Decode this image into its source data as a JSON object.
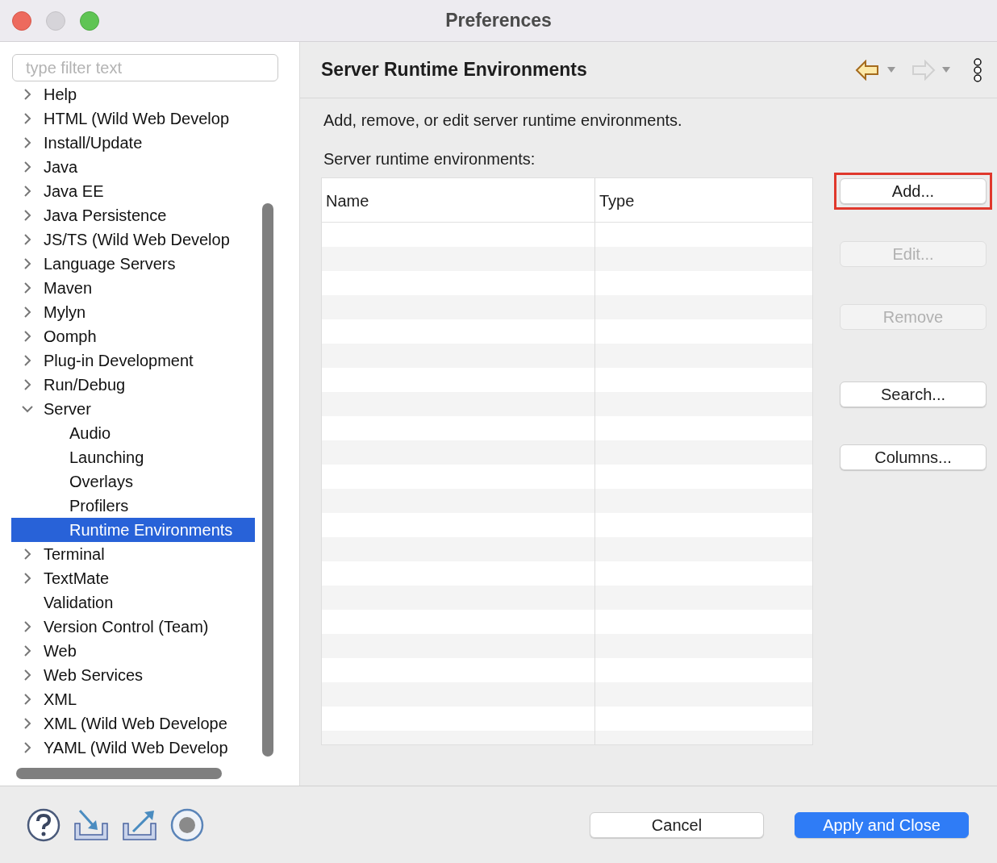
{
  "window": {
    "title": "Preferences"
  },
  "filter": {
    "placeholder": "type filter text"
  },
  "tree": [
    {
      "label": "Help",
      "expandable": true,
      "expanded": false,
      "selected": false
    },
    {
      "label": "HTML (Wild Web Develop",
      "expandable": true,
      "expanded": false,
      "selected": false
    },
    {
      "label": "Install/Update",
      "expandable": true,
      "expanded": false,
      "selected": false
    },
    {
      "label": "Java",
      "expandable": true,
      "expanded": false,
      "selected": false
    },
    {
      "label": "Java EE",
      "expandable": true,
      "expanded": false,
      "selected": false
    },
    {
      "label": "Java Persistence",
      "expandable": true,
      "expanded": false,
      "selected": false
    },
    {
      "label": "JS/TS (Wild Web Develop",
      "expandable": true,
      "expanded": false,
      "selected": false
    },
    {
      "label": "Language Servers",
      "expandable": true,
      "expanded": false,
      "selected": false
    },
    {
      "label": "Maven",
      "expandable": true,
      "expanded": false,
      "selected": false
    },
    {
      "label": "Mylyn",
      "expandable": true,
      "expanded": false,
      "selected": false
    },
    {
      "label": "Oomph",
      "expandable": true,
      "expanded": false,
      "selected": false
    },
    {
      "label": "Plug-in Development",
      "expandable": true,
      "expanded": false,
      "selected": false
    },
    {
      "label": "Run/Debug",
      "expandable": true,
      "expanded": false,
      "selected": false
    },
    {
      "label": "Server",
      "expandable": true,
      "expanded": true,
      "selected": false,
      "children": [
        {
          "label": "Audio",
          "selected": false
        },
        {
          "label": "Launching",
          "selected": false
        },
        {
          "label": "Overlays",
          "selected": false
        },
        {
          "label": "Profilers",
          "selected": false
        },
        {
          "label": "Runtime Environments",
          "selected": true
        }
      ]
    },
    {
      "label": "Terminal",
      "expandable": true,
      "expanded": false,
      "selected": false
    },
    {
      "label": "TextMate",
      "expandable": true,
      "expanded": false,
      "selected": false
    },
    {
      "label": "Validation",
      "expandable": false,
      "selected": false
    },
    {
      "label": "Version Control (Team)",
      "expandable": true,
      "expanded": false,
      "selected": false
    },
    {
      "label": "Web",
      "expandable": true,
      "expanded": false,
      "selected": false
    },
    {
      "label": "Web Services",
      "expandable": true,
      "expanded": false,
      "selected": false
    },
    {
      "label": "XML",
      "expandable": true,
      "expanded": false,
      "selected": false
    },
    {
      "label": "XML (Wild Web Develope",
      "expandable": true,
      "expanded": false,
      "selected": false
    },
    {
      "label": "YAML (Wild Web Develop",
      "expandable": true,
      "expanded": false,
      "selected": false
    }
  ],
  "page": {
    "title": "Server Runtime Environments",
    "description": "Add, remove, or edit server runtime environments.",
    "table_label": "Server runtime environments:"
  },
  "table": {
    "columns": [
      "Name",
      "Type"
    ]
  },
  "side_buttons": [
    {
      "label": "Add...",
      "disabled": false,
      "highlighted": true
    },
    {
      "label": "Edit...",
      "disabled": true,
      "highlighted": false
    },
    {
      "label": "Remove",
      "disabled": true,
      "highlighted": false
    },
    {
      "label": "Search...",
      "disabled": false,
      "highlighted": false
    },
    {
      "label": "Columns...",
      "disabled": false,
      "highlighted": false
    }
  ],
  "footer_buttons": [
    {
      "label": "Cancel",
      "kind": "secondary"
    },
    {
      "label": "Apply and Close",
      "kind": "primary"
    }
  ]
}
